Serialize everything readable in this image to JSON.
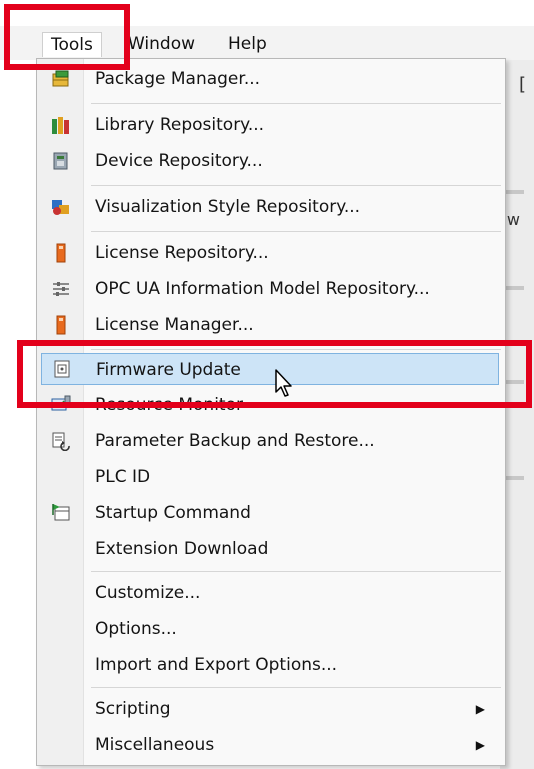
{
  "menubar": {
    "items": [
      {
        "label": "Tools",
        "active": true
      },
      {
        "label": "Window",
        "active": false
      },
      {
        "label": "Help",
        "active": false
      }
    ]
  },
  "background": {
    "bracket": "[",
    "w": "w"
  },
  "tools_menu": {
    "items": [
      {
        "label": "Package Manager...",
        "icon": "package-icon"
      },
      {
        "label": "Library Repository...",
        "icon": "library-books-icon"
      },
      {
        "label": "Device Repository...",
        "icon": "device-icon"
      },
      {
        "label": "Visualization Style Repository...",
        "icon": "visualization-icon"
      },
      {
        "label": "License Repository...",
        "icon": "license-icon"
      },
      {
        "label": "OPC UA Information Model Repository...",
        "icon": "opc-ua-icon"
      },
      {
        "label": "License Manager...",
        "icon": "license-icon"
      },
      {
        "label": "Firmware Update",
        "icon": "firmware-icon",
        "highlighted": true
      },
      {
        "label": "Resource Monitor",
        "icon": "resource-monitor-icon"
      },
      {
        "label": "Parameter Backup and Restore...",
        "icon": "backup-restore-icon"
      },
      {
        "label": "PLC ID"
      },
      {
        "label": "Startup Command",
        "icon": "startup-flag-icon"
      },
      {
        "label": "Extension Download"
      },
      {
        "label": "Customize..."
      },
      {
        "label": "Options..."
      },
      {
        "label": "Import and Export Options..."
      },
      {
        "label": "Scripting",
        "submenu": true
      },
      {
        "label": "Miscellaneous",
        "submenu": true
      }
    ]
  },
  "colors": {
    "highlight_bg": "#cde4f7",
    "highlight_border": "#7fb3e0",
    "annotation_red": "#e3001b"
  }
}
